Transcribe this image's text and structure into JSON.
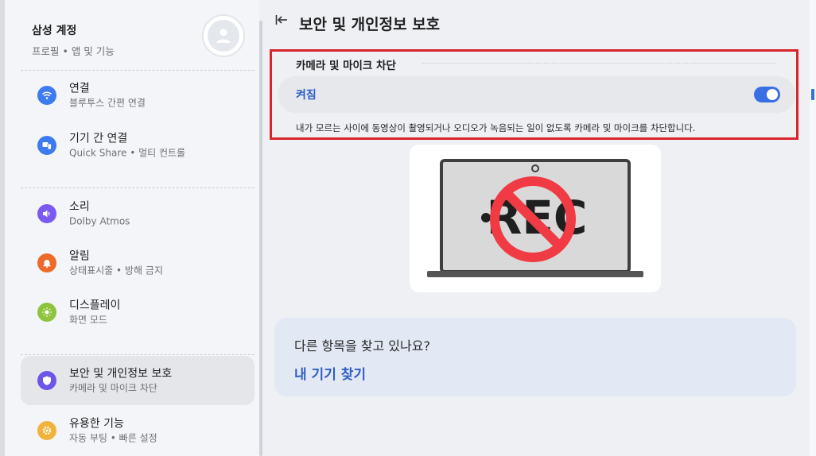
{
  "sidebar": {
    "profile": {
      "name": "삼성 계정",
      "sub": "프로필 • 앱 및 기능"
    },
    "items": [
      {
        "label": "연결",
        "sub": "블루투스 간편 연결",
        "icon": "wifi-icon",
        "color": "#3d7bf0"
      },
      {
        "label": "기기 간 연결",
        "sub": "Quick Share  •  멀티 컨트롤",
        "icon": "devices-icon",
        "color": "#3d7bf0"
      },
      {
        "label": "소리",
        "sub": "Dolby Atmos",
        "icon": "speaker-icon",
        "color": "#7a5af0"
      },
      {
        "label": "알림",
        "sub": "상태표시줄 • 방해 금지",
        "icon": "bell-icon",
        "color": "#ee6a2a"
      },
      {
        "label": "디스플레이",
        "sub": "화면 모드",
        "icon": "brightness-icon",
        "color": "#8dc43c"
      },
      {
        "label": "보안 및 개인정보 보호",
        "sub": "카메라 및 마이크 차단",
        "icon": "shield-icon",
        "color": "#6e55e8"
      },
      {
        "label": "유용한 기능",
        "sub": "자동 부팅  •  빠른 설정",
        "icon": "gear-icon",
        "color": "#f0b43c"
      }
    ]
  },
  "header": {
    "title": "보안 및 개인정보 보호"
  },
  "section": {
    "title": "카메라 및 마이크 차단",
    "toggle_label": "켜짐",
    "toggle_on": true,
    "description": "내가 모르는 사이에 동영상이 촬영되거나 오디오가 녹음되는 일이 없도록 카메라 및 마이크를 차단합니다."
  },
  "illustration": {
    "text": "REC"
  },
  "help": {
    "question": "다른 항목을 찾고 있나요?",
    "link": "내 기기 찾기"
  }
}
